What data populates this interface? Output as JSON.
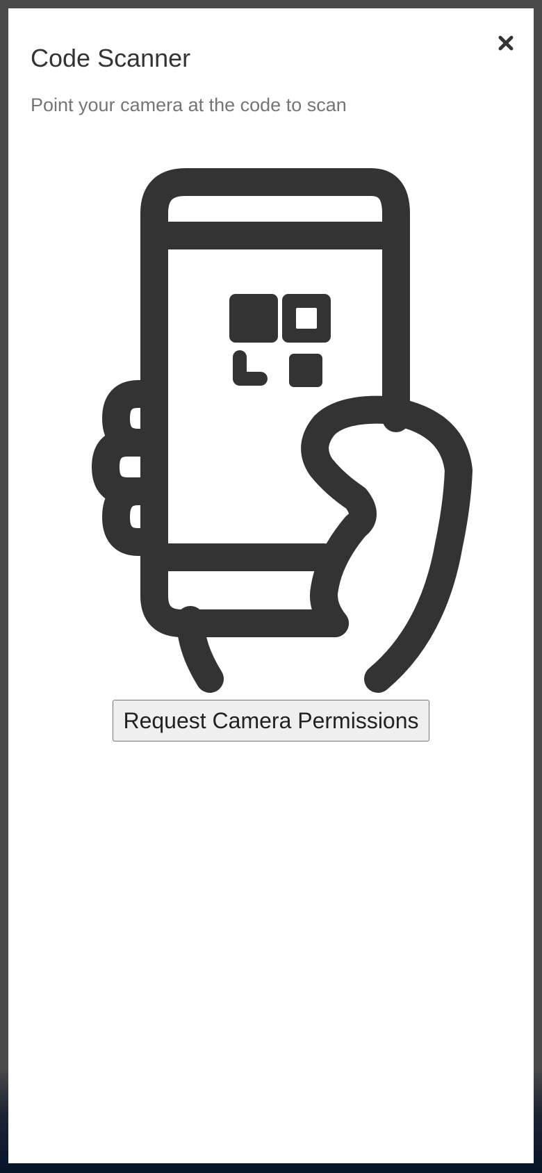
{
  "dialog": {
    "title": "Code Scanner",
    "subtitle": "Point your camera at the code to scan",
    "close_icon": "close-icon",
    "illustration_icon": "hand-holding-phone-qr-icon",
    "request_button_label": "Request Camera Permissions"
  },
  "colors": {
    "backdrop": "#4a4a4a",
    "surface": "#ffffff",
    "title_text": "#333333",
    "subtitle_text": "#757575",
    "illustration": "#333333",
    "button_bg": "#efefef",
    "button_border": "#767676"
  }
}
